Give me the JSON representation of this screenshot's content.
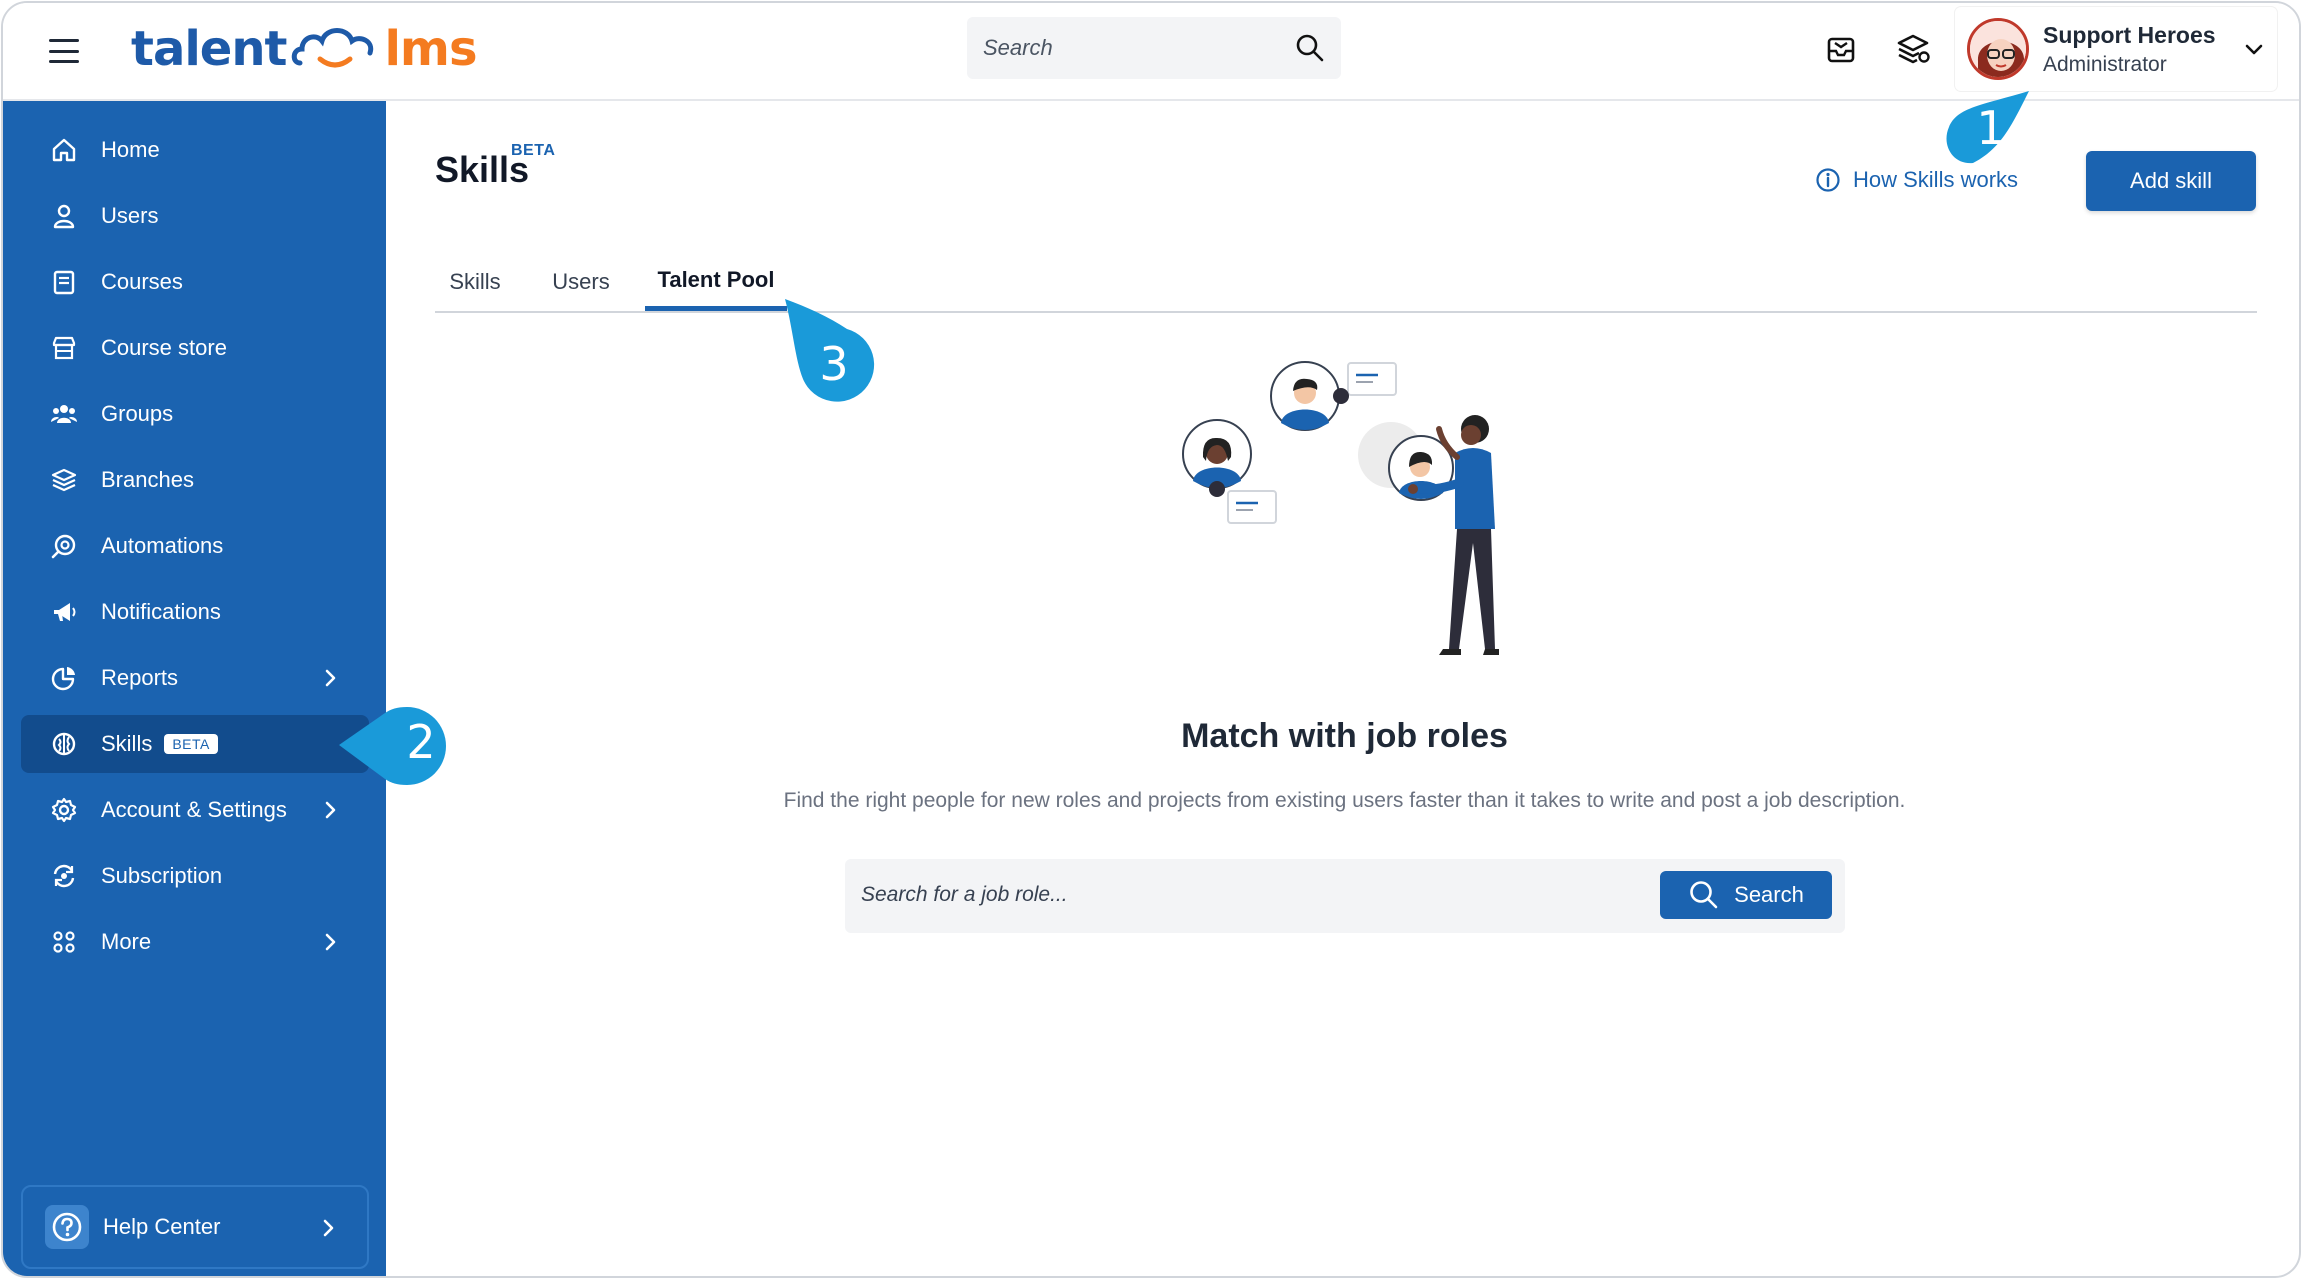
{
  "header": {
    "logo_left": "talent",
    "logo_right": "lms",
    "search_placeholder": "Search",
    "user_name": "Support Heroes",
    "user_role": "Administrator"
  },
  "sidebar": {
    "items": [
      {
        "label": "Home",
        "icon": "home-icon"
      },
      {
        "label": "Users",
        "icon": "user-icon"
      },
      {
        "label": "Courses",
        "icon": "book-icon"
      },
      {
        "label": "Course store",
        "icon": "store-icon"
      },
      {
        "label": "Groups",
        "icon": "groups-icon"
      },
      {
        "label": "Branches",
        "icon": "layers-icon"
      },
      {
        "label": "Automations",
        "icon": "automation-icon"
      },
      {
        "label": "Notifications",
        "icon": "megaphone-icon"
      },
      {
        "label": "Reports",
        "icon": "pie-chart-icon"
      },
      {
        "label": "Skills",
        "icon": "brain-icon",
        "badge": "BETA",
        "active": true
      },
      {
        "label": "Account & Settings",
        "icon": "gear-icon"
      },
      {
        "label": "Subscription",
        "icon": "subscription-icon"
      },
      {
        "label": "More",
        "icon": "grid-icon"
      }
    ],
    "help_label": "Help Center"
  },
  "main": {
    "title": "Skills",
    "title_badge": "BETA",
    "how_link": "How Skills works",
    "add_button": "Add skill",
    "tabs": [
      "Skills",
      "Users",
      "Talent Pool"
    ],
    "active_tab": "Talent Pool",
    "hero_title": "Match with job roles",
    "hero_subtitle": "Find the right people for new roles and projects from existing users faster than it takes to write and post a job description.",
    "role_search_placeholder": "Search for a job role...",
    "role_search_button": "Search"
  },
  "callouts": [
    "1",
    "2",
    "3"
  ],
  "colors": {
    "brand_blue": "#1b63b0",
    "brand_orange": "#f47b20",
    "callout": "#1a9ad9"
  }
}
